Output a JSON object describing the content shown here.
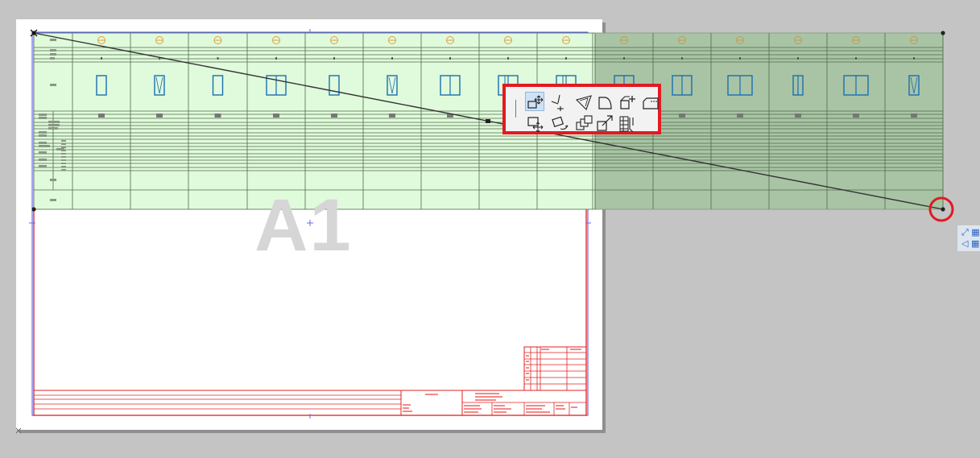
{
  "sheet": {
    "label": "A1"
  },
  "colors": {
    "background": "#c4c4c4",
    "paper": "#ffffff",
    "title_block": "#e02020",
    "margin_frame": "#4a4ae8",
    "schedule_fill": "#e0fadc",
    "schedule_selected": "#a9c4a5",
    "window_symbol": "#1a6fb0",
    "header_symbol": "#e3a03c",
    "highlight": "#e21a22"
  },
  "schedule": {
    "columns_on_sheet": 9,
    "columns_off_sheet": 6
  },
  "pet_palette": {
    "rows": [
      [
        {
          "name": "drag-icon",
          "active": true
        },
        {
          "name": "stretch-node-icon",
          "active": false
        },
        {
          "name": "offset-icon",
          "active": false
        },
        {
          "name": "curved-edge-icon",
          "active": false
        },
        {
          "name": "add-to-polygon-icon",
          "active": false
        },
        {
          "name": "subtract-from-polygon-icon",
          "active": false
        }
      ],
      [
        {
          "name": "move-icon",
          "active": false
        },
        {
          "name": "rotate-icon",
          "active": false
        },
        {
          "name": "multiply-icon",
          "active": false
        },
        {
          "name": "resize-icon",
          "active": false
        },
        {
          "name": "split-table-icon",
          "active": false
        }
      ]
    ]
  },
  "side_tools": [
    {
      "name": "stretch-icon",
      "glyph": "⤢ ▦"
    },
    {
      "name": "mirror-icon",
      "glyph": "◁ ▦"
    }
  ]
}
